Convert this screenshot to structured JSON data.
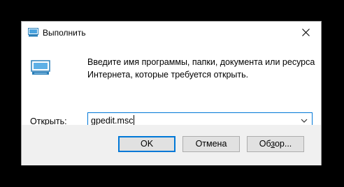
{
  "window": {
    "title": "Выполнить"
  },
  "description": {
    "line1": "Введите имя программы, папки, документа или ресурса",
    "line2": "Интернета, которые требуется открыть."
  },
  "open_field": {
    "label_first": "О",
    "label_rest": "ткрыть:",
    "value": "gpedit.msc"
  },
  "buttons": {
    "ok": "OK",
    "cancel": "Отмена",
    "browse_first": "Об",
    "browse_underlined": "з",
    "browse_rest": "ор..."
  },
  "icons": {
    "title": "run-icon",
    "content": "run-icon",
    "close": "close-icon",
    "dropdown": "chevron-down-icon"
  },
  "colors": {
    "accent": "#0078d7",
    "footer_bg": "#f0f0f0",
    "button_bg": "#e1e1e1"
  }
}
